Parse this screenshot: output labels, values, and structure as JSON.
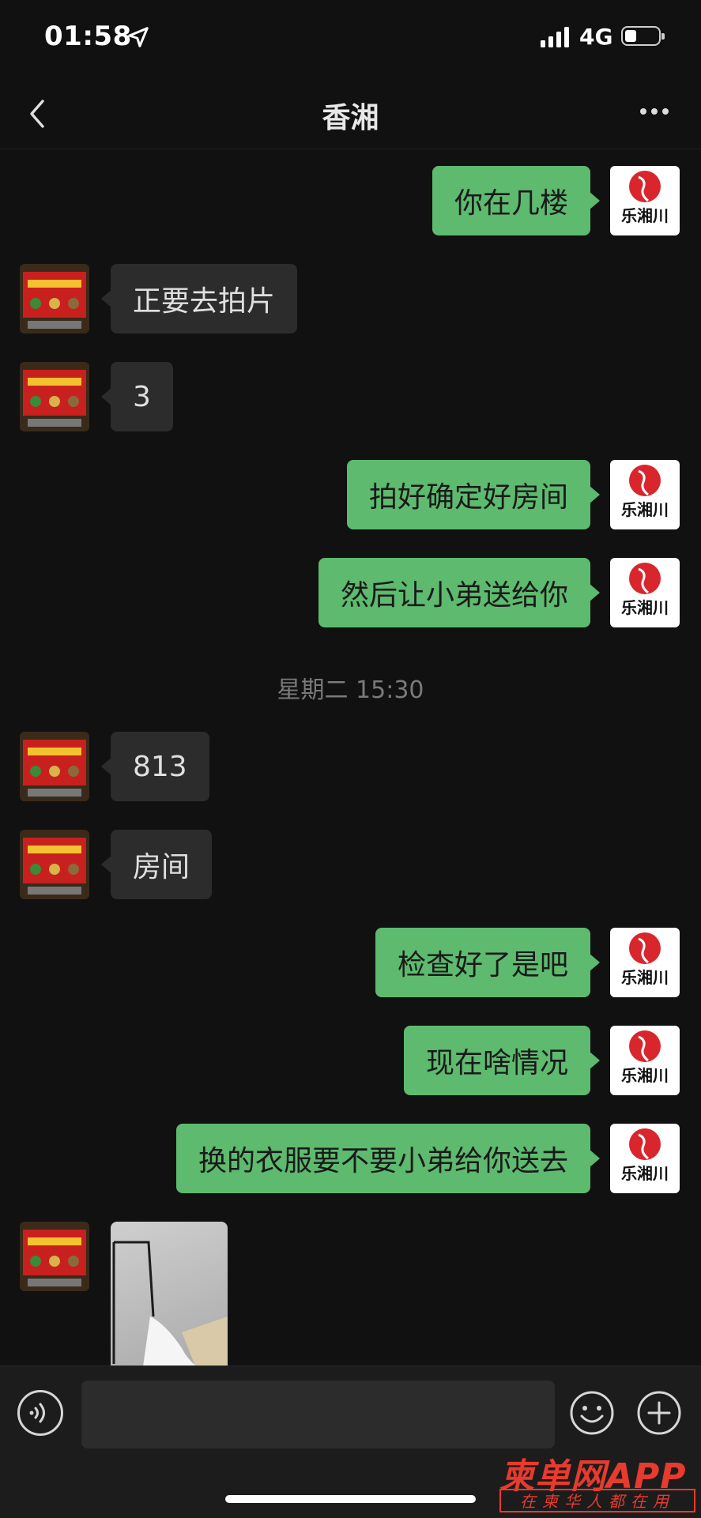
{
  "status_bar": {
    "time": "01:58",
    "network": "4G"
  },
  "header": {
    "title": "香湘"
  },
  "messages": [
    {
      "from": "me",
      "text": "你在几楼"
    },
    {
      "from": "them",
      "text": "正要去拍片"
    },
    {
      "from": "them",
      "text": "3"
    },
    {
      "from": "me",
      "text": "拍好确定好房间"
    },
    {
      "from": "me",
      "text": "然后让小弟送给你"
    },
    {
      "timestamp": "星期二 15:30"
    },
    {
      "from": "them",
      "text": "813"
    },
    {
      "from": "them",
      "text": "房间"
    },
    {
      "from": "me",
      "text": "检查好了是吧"
    },
    {
      "from": "me",
      "text": "现在啥情况"
    },
    {
      "from": "me",
      "text": "换的衣服要不要小弟给你送去"
    },
    {
      "from": "them",
      "type": "image"
    }
  ],
  "my_avatar_text": "乐湘川",
  "colors": {
    "sent_bubble": "#5dba6e",
    "received_bubble": "#2c2c2c",
    "background": "#111111"
  },
  "watermark": {
    "brand": "柬单网APP",
    "tagline": "在柬华人都在用"
  }
}
